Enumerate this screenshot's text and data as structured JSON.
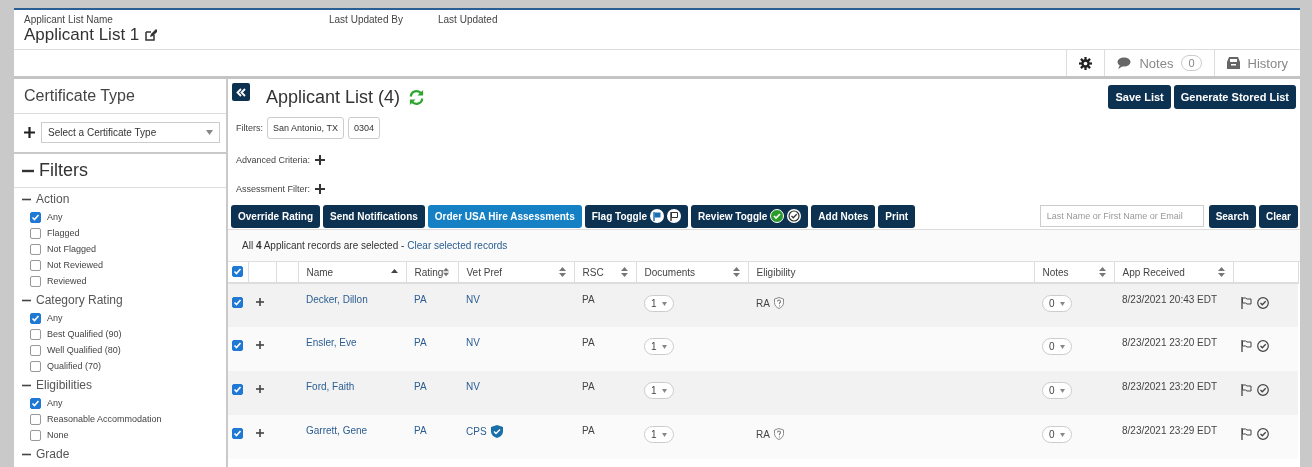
{
  "header": {
    "name_label": "Applicant List Name",
    "name": "Applicant List 1",
    "updated_by_label": "Last Updated By",
    "updated_label": "Last Updated"
  },
  "toolbar": {
    "notes_label": "Notes",
    "notes_count": "0",
    "history_label": "History"
  },
  "certificate": {
    "title": "Certificate Type",
    "placeholder": "Select a Certificate Type"
  },
  "filters": {
    "title": "Filters",
    "expanded": true,
    "groups": [
      {
        "title": "Action",
        "expanded": true,
        "options": [
          {
            "label": "Any",
            "checked": true
          },
          {
            "label": "Flagged",
            "checked": false
          },
          {
            "label": "Not Flagged",
            "checked": false
          },
          {
            "label": "Not Reviewed",
            "checked": false
          },
          {
            "label": "Reviewed",
            "checked": false
          }
        ]
      },
      {
        "title": "Category Rating",
        "expanded": true,
        "options": [
          {
            "label": "Any",
            "checked": true
          },
          {
            "label": "Best Qualified (90)",
            "checked": false
          },
          {
            "label": "Well Qualified (80)",
            "checked": false
          },
          {
            "label": "Qualified (70)",
            "checked": false
          }
        ]
      },
      {
        "title": "Eligibilities",
        "expanded": true,
        "options": [
          {
            "label": "Any",
            "checked": true
          },
          {
            "label": "Reasonable Accommodation",
            "checked": false
          },
          {
            "label": "None",
            "checked": false
          }
        ]
      },
      {
        "title": "Grade",
        "expanded": true
      }
    ]
  },
  "main": {
    "title": "Applicant List (4)",
    "top_buttons": [
      "Save List",
      "Generate Stored List"
    ],
    "filters_label": "Filters:",
    "filter_chips": [
      "San Antonio, TX",
      "0304"
    ],
    "advanced_label": "Advanced Criteria:",
    "assessment_label": "Assessment Filter:"
  },
  "actions": [
    {
      "label": "Override Rating",
      "kind": "plain",
      "highlighted": false
    },
    {
      "label": "Send Notifications",
      "kind": "plain",
      "highlighted": false
    },
    {
      "label": "Order USA Hire Assessments",
      "kind": "plain",
      "highlighted": true
    },
    {
      "label": "Flag Toggle",
      "kind": "flag",
      "highlighted": false
    },
    {
      "label": "Review Toggle",
      "kind": "review",
      "highlighted": false
    },
    {
      "label": "Add Notes",
      "kind": "plain",
      "highlighted": false
    },
    {
      "label": "Print",
      "kind": "plain",
      "highlighted": false
    }
  ],
  "search": {
    "placeholder": "Last Name or First Name or Email",
    "buttons": [
      "Search",
      "Clear"
    ]
  },
  "selection": {
    "message": "All **4** Applicant records are selected -",
    "link": "Clear selected records"
  },
  "table": {
    "all_selected": true,
    "columns": [
      {
        "label": "Name",
        "sortable": true,
        "sorted": true
      },
      {
        "label": "Rating",
        "sortable": true,
        "sorted": false
      },
      {
        "label": "Vet Pref",
        "sortable": true,
        "sorted": false
      },
      {
        "label": "RSC",
        "sortable": true,
        "sorted": false
      },
      {
        "label": "Documents",
        "sortable": true,
        "sorted": false
      },
      {
        "label": "Eligibility",
        "sortable": false
      },
      {
        "label": "Notes",
        "sortable": true,
        "sorted": false
      },
      {
        "label": "App Received",
        "sortable": true,
        "sorted": false
      }
    ],
    "rows": [
      {
        "selected": true,
        "expanded": false,
        "name": "Decker, Dillon",
        "rating": "PA",
        "vet_pref": "NV",
        "verified": false,
        "rsc": "PA",
        "documents": "1",
        "eligibility": "RA",
        "notes": "0",
        "received": "8/23/2021 20:43 EDT",
        "flagged": false,
        "reviewed": false
      },
      {
        "selected": true,
        "expanded": false,
        "name": "Ensler, Eve",
        "rating": "PA",
        "vet_pref": "NV",
        "verified": false,
        "rsc": "PA",
        "documents": "1",
        "notes": "0",
        "received": "8/23/2021 23:20 EDT",
        "flagged": false,
        "reviewed": false
      },
      {
        "selected": true,
        "expanded": false,
        "name": "Ford, Faith",
        "rating": "PA",
        "vet_pref": "NV",
        "verified": false,
        "rsc": "PA",
        "documents": "1",
        "notes": "0",
        "received": "8/23/2021 23:20 EDT",
        "flagged": false,
        "reviewed": false
      },
      {
        "selected": true,
        "expanded": false,
        "name": "Garrett, Gene",
        "rating": "PA",
        "vet_pref": "CPS",
        "verified": true,
        "rsc": "PA",
        "documents": "1",
        "eligibility": "RA",
        "notes": "0",
        "received": "8/23/2021 23:29 EDT",
        "flagged": false,
        "reviewed": false
      }
    ]
  }
}
